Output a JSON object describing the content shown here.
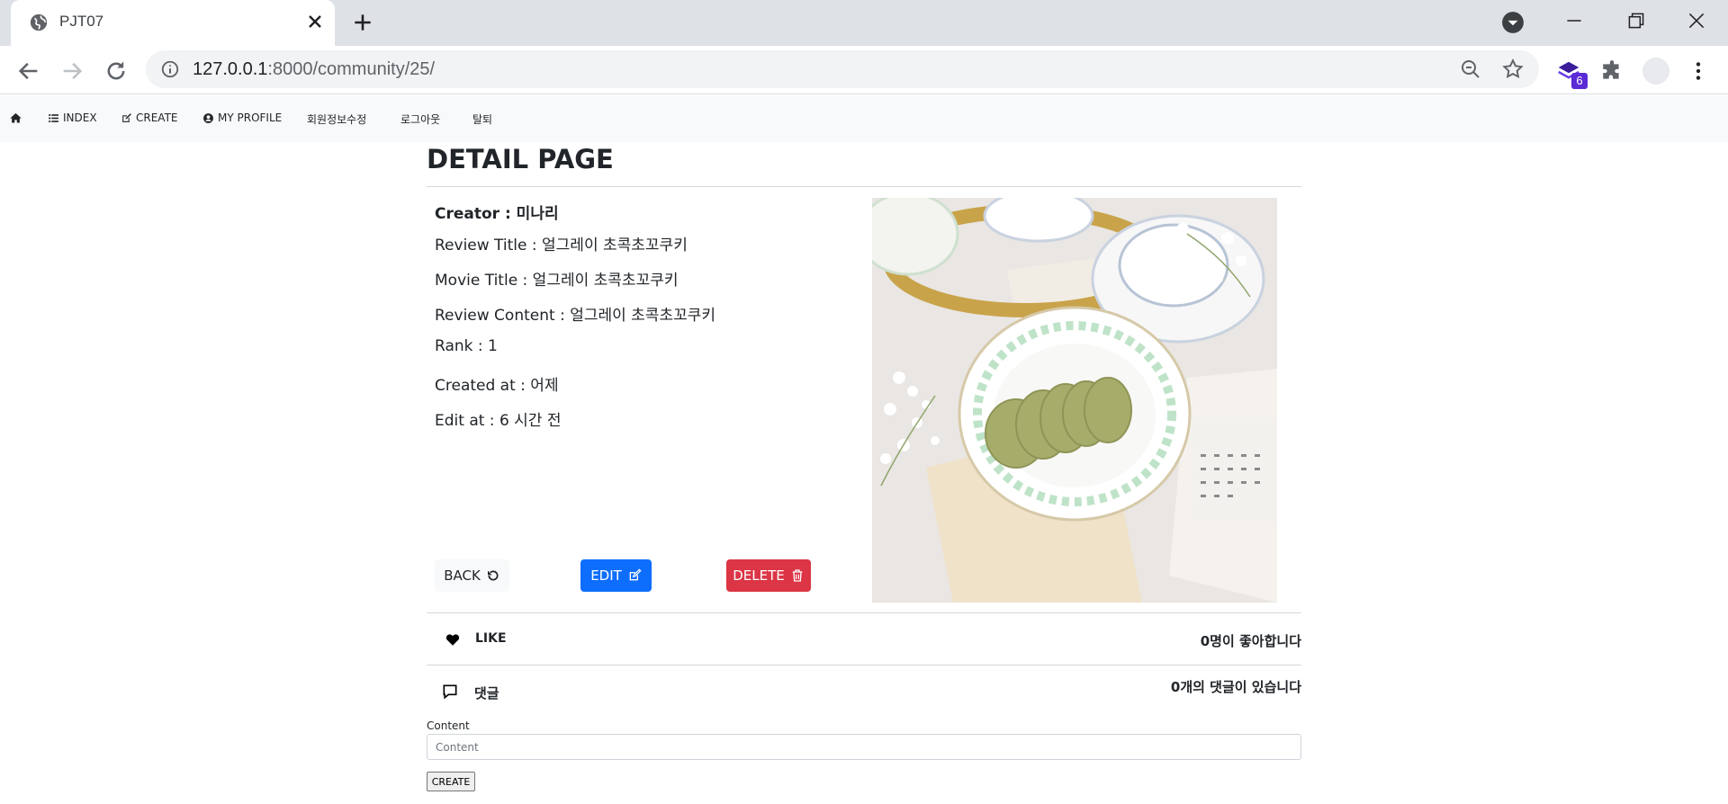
{
  "browser": {
    "tab_title": "PJT07",
    "url_host": "127.0.0.1",
    "url_path": ":8000/community/25/",
    "extension_badge": "6"
  },
  "nav": {
    "index_label": "INDEX",
    "create_label": "CREATE",
    "profile_label": "MY PROFILE",
    "edit_info_label": "회원정보수정",
    "logout_label": "로그아웃",
    "withdraw_label": "탈퇴"
  },
  "detail": {
    "page_title": "DETAIL PAGE",
    "creator": "Creator : 미나리",
    "review_title": "Review Title : 얼그레이 초콕초꼬쿠키",
    "movie_title": "Movie Title : 얼그레이 초콕초꼬쿠키",
    "review_content": "Review Content : 얼그레이 초콕초꼬쿠키",
    "rank": "Rank : 1",
    "created_at": "Created at : 어제",
    "edit_at": "Edit at : 6 시간 전"
  },
  "actions": {
    "back_label": "BACK",
    "edit_label": "EDIT",
    "delete_label": "DELETE"
  },
  "like": {
    "label": "LIKE",
    "count_text": "0명이 좋아합니다"
  },
  "comments": {
    "label": "댓글",
    "count_text": "0개의 댓글이 있습니다",
    "field_label": "Content",
    "placeholder": "Content",
    "submit_label": "CREATE"
  },
  "colors": {
    "edit": "#0d6efd",
    "delete": "#dc3545",
    "nav_bg": "#f8f9fa"
  }
}
